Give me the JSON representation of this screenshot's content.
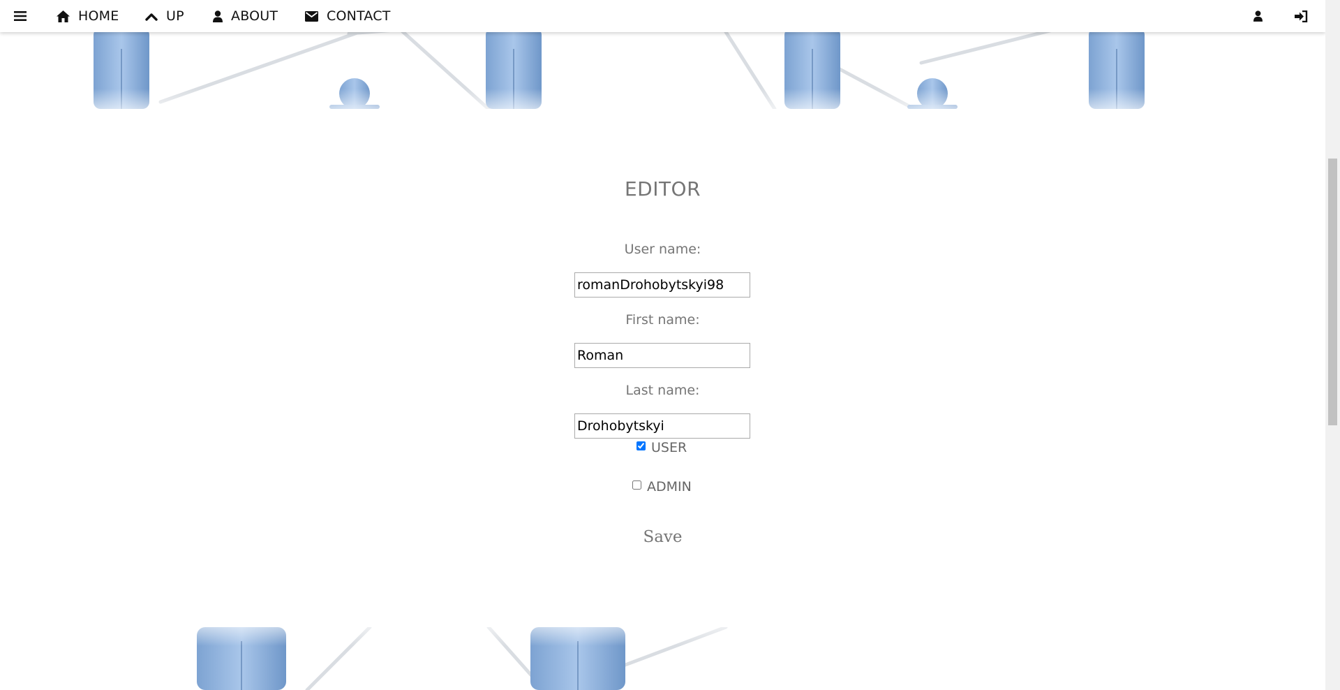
{
  "navbar": {
    "items": [
      {
        "label": "HOME",
        "icon": "home-icon"
      },
      {
        "label": "UP",
        "icon": "chevron-up-icon"
      },
      {
        "label": "ABOUT",
        "icon": "user-icon"
      },
      {
        "label": "CONTACT",
        "icon": "envelope-icon"
      }
    ],
    "menu_icon": "hamburger-menu-icon",
    "right_icons": [
      "user-profile-icon",
      "sign-in-icon"
    ]
  },
  "editor": {
    "title": "EDITOR",
    "fields": {
      "username": {
        "label": "User name:",
        "value": "romanDrohobytskyi98"
      },
      "firstname": {
        "label": "First name:",
        "value": "Roman"
      },
      "lastname": {
        "label": "Last name:",
        "value": "Drohobytskyi"
      }
    },
    "roles": [
      {
        "label": "USER",
        "checked": true
      },
      {
        "label": "ADMIN",
        "checked": false
      }
    ],
    "save_label": "Save"
  },
  "colors": {
    "figure_blue": "#8fb2dc",
    "label_gray": "#757575",
    "navbar_bg": "#ffffff"
  }
}
